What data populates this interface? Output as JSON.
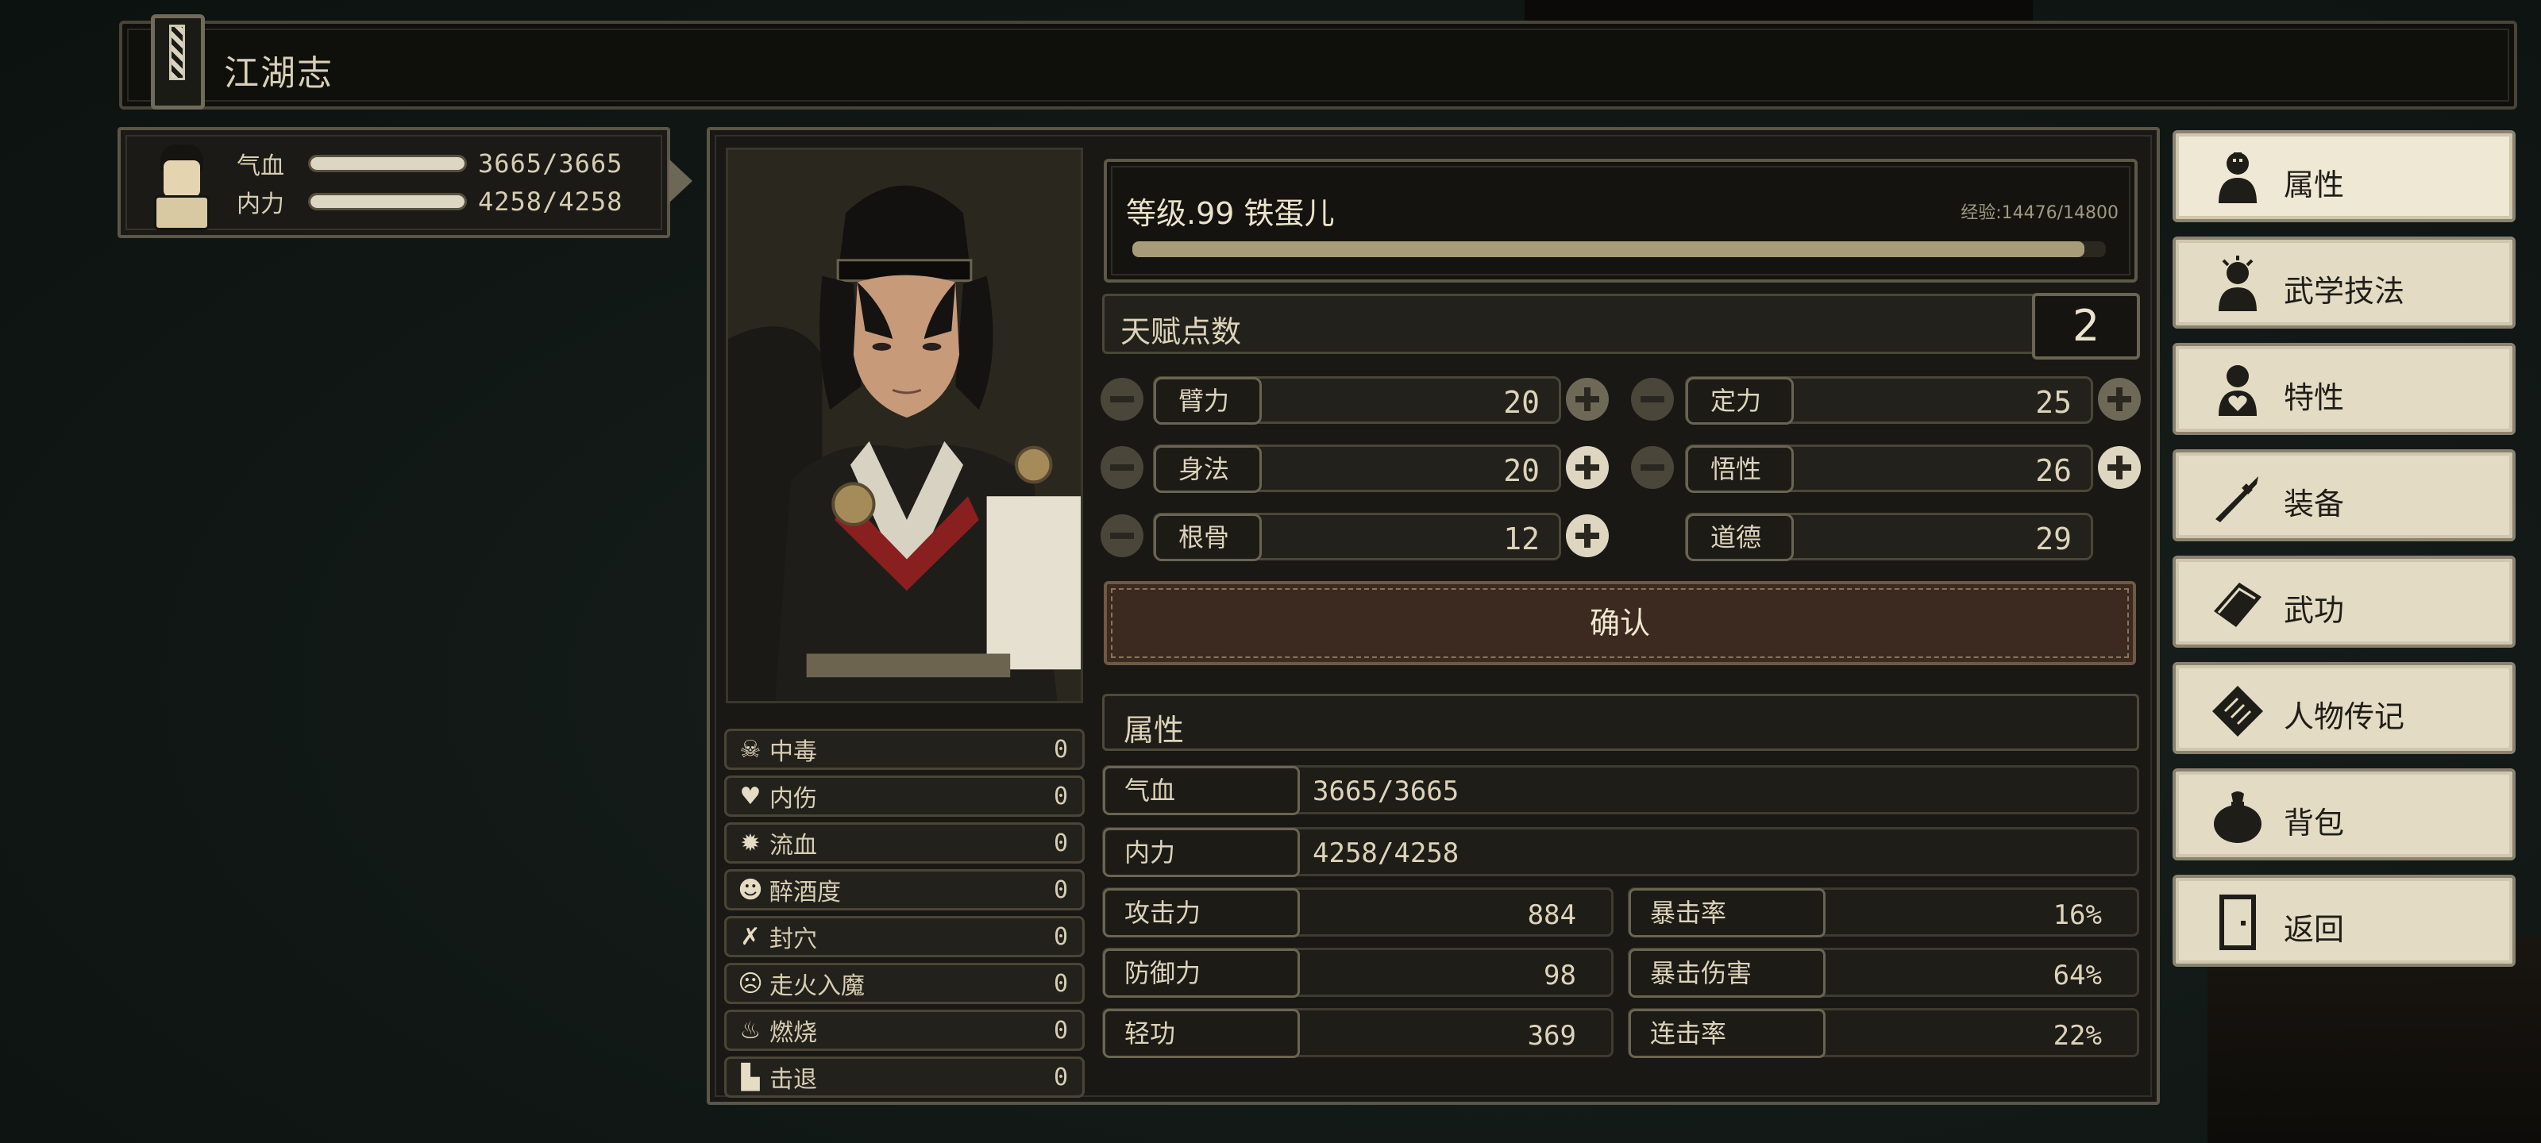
{
  "title": "江湖志",
  "mini": {
    "hp_label": "气血",
    "hp_value": "3665/3665",
    "hp_fill": 1.0,
    "mp_label": "内力",
    "mp_value": "4258/4258",
    "mp_fill": 1.0
  },
  "character": {
    "level_text": "等级.99  铁蛋儿",
    "exp_text": "经验:14476/14800",
    "exp_fill": 0.978
  },
  "talent": {
    "label": "天赋点数",
    "points": "2"
  },
  "attributes": [
    {
      "name": "臂力",
      "value": "20"
    },
    {
      "name": "定力",
      "value": "25"
    },
    {
      "name": "身法",
      "value": "20"
    },
    {
      "name": "悟性",
      "value": "26"
    },
    {
      "name": "根骨",
      "value": "12"
    },
    {
      "name": "道德",
      "value": "29"
    }
  ],
  "confirm_label": "确认",
  "section_title": "属性",
  "stats": {
    "hp_label": "气血",
    "hp_value": "3665/3665",
    "mp_label": "内力",
    "mp_value": "4258/4258",
    "attack_label": "攻击力",
    "attack_value": "884",
    "defense_label": "防御力",
    "defense_value": "98",
    "qinggong_label": "轻功",
    "qinggong_value": "369",
    "crit_rate_label": "暴击率",
    "crit_rate_value": "16%",
    "crit_dmg_label": "暴击伤害",
    "crit_dmg_value": "64%",
    "combo_label": "连击率",
    "combo_value": "22%"
  },
  "statuses": [
    {
      "icon": "skull-icon",
      "name": "中毒",
      "value": "0"
    },
    {
      "icon": "broken-heart-icon",
      "name": "内伤",
      "value": "0"
    },
    {
      "icon": "blood-drop-icon",
      "name": "流血",
      "value": "0"
    },
    {
      "icon": "drunk-face-icon",
      "name": "醉酒度",
      "value": "0"
    },
    {
      "icon": "pressure-point-icon",
      "name": "封穴",
      "value": "0"
    },
    {
      "icon": "demon-face-icon",
      "name": "走火入魔",
      "value": "0"
    },
    {
      "icon": "fire-icon",
      "name": "燃烧",
      "value": "0"
    },
    {
      "icon": "boot-icon",
      "name": "击退",
      "value": "0"
    }
  ],
  "menu": [
    {
      "icon": "person-icon",
      "label": "属性"
    },
    {
      "icon": "martial-person-icon",
      "label": "武学技法"
    },
    {
      "icon": "heart-person-icon",
      "label": "特性"
    },
    {
      "icon": "sword-icon",
      "label": "装备"
    },
    {
      "icon": "scroll-book-icon",
      "label": "武功"
    },
    {
      "icon": "biography-book-icon",
      "label": "人物传记"
    },
    {
      "icon": "bag-icon",
      "label": "背包"
    },
    {
      "icon": "door-icon",
      "label": "返回"
    }
  ]
}
